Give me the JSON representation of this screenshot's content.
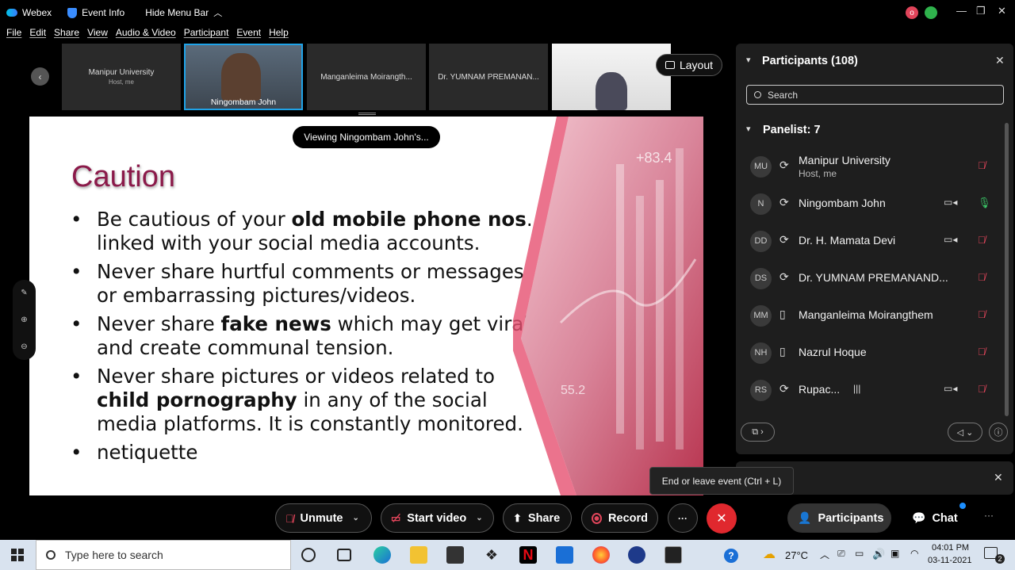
{
  "titlebar": {
    "app_name": "Webex",
    "event_info": "Event Info",
    "hide_menu": "Hide Menu Bar",
    "avatar_letter": "o"
  },
  "menu": [
    "File",
    "Edit",
    "Share",
    "View",
    "Audio & Video",
    "Participant",
    "Event",
    "Help"
  ],
  "video_strip": {
    "tiles": [
      {
        "name": "Manipur University",
        "sub": "Host, me"
      },
      {
        "name": "Ningombam John",
        "sub": ""
      },
      {
        "name": "Manganleima Moirangth...",
        "sub": ""
      },
      {
        "name": "Dr. YUMNAM PREMANAN...",
        "sub": ""
      }
    ],
    "layout_label": "Layout"
  },
  "viewing_pill": "Viewing Ningombam John's...",
  "slide": {
    "title": "Caution",
    "bullets": [
      {
        "pre": "Be cautious of your ",
        "bold": "old mobile phone nos",
        "post": ". linked with your social media accounts."
      },
      {
        "pre": "Never share hurtful comments or messages or embarrassing pictures/videos.",
        "bold": "",
        "post": ""
      },
      {
        "pre": "Never share ",
        "bold": "fake news",
        "post": " which may get viral and create communal tension."
      },
      {
        "pre": "Never share pictures or videos related to ",
        "bold": "child pornography",
        "post": " in any of the social media platforms. It is constantly monitored."
      },
      {
        "pre": "netiquette",
        "bold": "",
        "post": ""
      }
    ],
    "image_numbers": [
      "+83.4",
      "55.2"
    ]
  },
  "panel": {
    "title": "Participants (108)",
    "search_placeholder": "Search",
    "section": "Panelist: 7",
    "participants": [
      {
        "initials": "MU",
        "name": "Manipur University",
        "sub": "Host, me",
        "camera": false
      },
      {
        "initials": "N",
        "name": "Ningombam John",
        "sub": "",
        "camera": true
      },
      {
        "initials": "DD",
        "name": "Dr. H. Mamata Devi",
        "sub": "",
        "camera": true
      },
      {
        "initials": "DS",
        "name": "Dr. YUMNAM PREMANAND...",
        "sub": "",
        "camera": false
      },
      {
        "initials": "MM",
        "name": "Manganleima Moirangthem",
        "sub": "",
        "camera": false
      },
      {
        "initials": "NH",
        "name": "Nazrul Hoque",
        "sub": "",
        "camera": false
      },
      {
        "initials": "RS",
        "name": "Rupac...",
        "sub": "",
        "camera": true
      }
    ]
  },
  "tooltip": "End or leave event (Ctrl + L)",
  "controls": {
    "unmute": "Unmute",
    "start_video": "Start video",
    "share": "Share",
    "record": "Record",
    "more": "···",
    "participants": "Participants",
    "chat": "Chat"
  },
  "taskbar": {
    "search_placeholder": "Type here to search",
    "temperature": "27°C",
    "time": "04:01 PM",
    "date": "03-11-2021",
    "notification_count": "2"
  },
  "colors": {
    "slide_title": "#8b1a4a",
    "end_button": "#e0282e",
    "mic_muted": "#e0455a",
    "active_tile_border": "#1fa3e8"
  }
}
